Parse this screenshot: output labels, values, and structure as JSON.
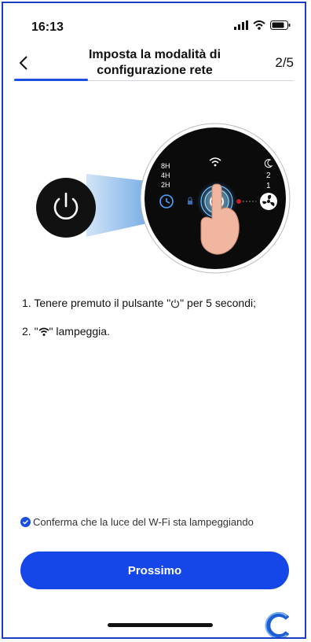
{
  "status": {
    "time": "16:13"
  },
  "header": {
    "title": "Imposta la modalità di configurazione rete",
    "step": "2/5",
    "progress": 0.25
  },
  "device_panel": {
    "timer_labels": [
      "8H",
      "4H",
      "2H"
    ],
    "speed_labels": [
      "2",
      "1"
    ]
  },
  "instructions": {
    "step1_before": "1. Tenere premuto il pulsante \"",
    "step1_after": "\" per 5 secondi;",
    "step2_before": "2. \"",
    "step2_after": "\" lampeggia."
  },
  "confirm": {
    "label": "Conferma che la luce del W-Fi sta lampeggiando",
    "checked": true
  },
  "next_button": {
    "label": "Prossimo"
  },
  "colors": {
    "accent": "#1547e8",
    "frame": "#1a3fc6"
  },
  "icons": [
    "back-arrow-icon",
    "power-icon",
    "wifi-icon",
    "timer-icon",
    "lock-icon",
    "moon-icon",
    "fan-icon",
    "hand-icon",
    "check-icon"
  ]
}
